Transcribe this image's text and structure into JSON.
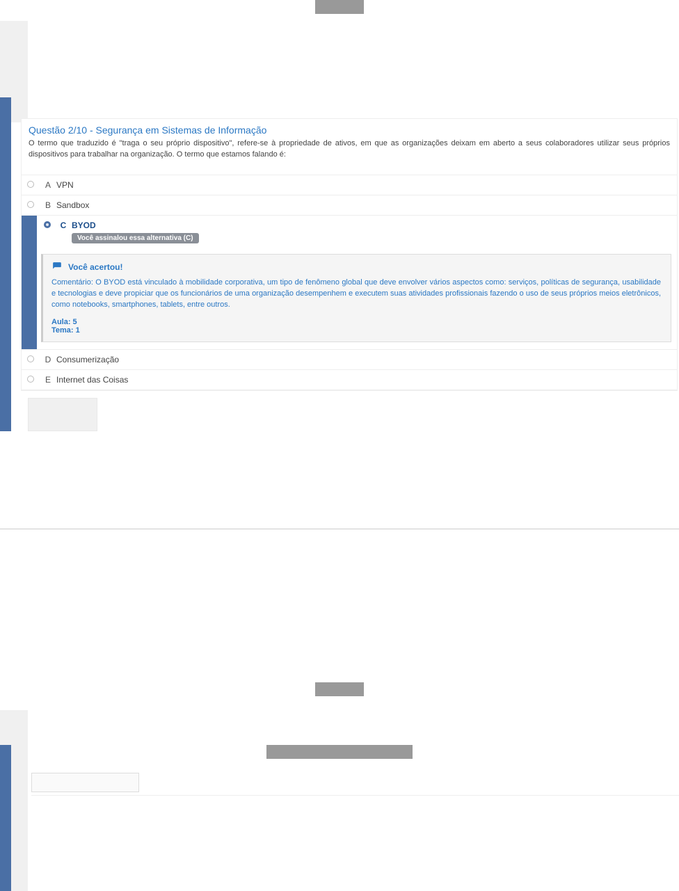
{
  "question": {
    "title": "Questão 2/10 - Segurança em Sistemas de Informação",
    "prompt": "O termo que traduzido é \"traga o seu próprio dispositivo\", refere-se à propriedade de ativos, em que as organizações deixam em aberto a seus colaboradores utilizar seus próprios dispositivos para trabalhar na organização. O termo que estamos falando é:",
    "options": [
      {
        "letter": "A",
        "text": "VPN",
        "selected": false
      },
      {
        "letter": "B",
        "text": "Sandbox",
        "selected": false
      },
      {
        "letter": "C",
        "text": "BYOD",
        "selected": true
      },
      {
        "letter": "D",
        "text": "Consumerização",
        "selected": false
      },
      {
        "letter": "E",
        "text": "Internet das Coisas",
        "selected": false
      }
    ],
    "selected_badge": "Você assinalou essa alternativa (C)",
    "feedback": {
      "head": "Você acertou!",
      "body": "Comentário: O BYOD está vinculado à mobilidade corporativa, um tipo de fenômeno global que deve envolver vários aspectos como: serviços, políticas de segurança, usabilidade e tecnologias e deve propiciar que os funcionários de uma organização desempenhem e executem suas atividades profissionais fazendo o uso de seus próprios meios eletrônicos, como notebooks, smartphones, tablets, entre outros.",
      "aula": "Aula: 5",
      "tema": "Tema: 1"
    }
  }
}
